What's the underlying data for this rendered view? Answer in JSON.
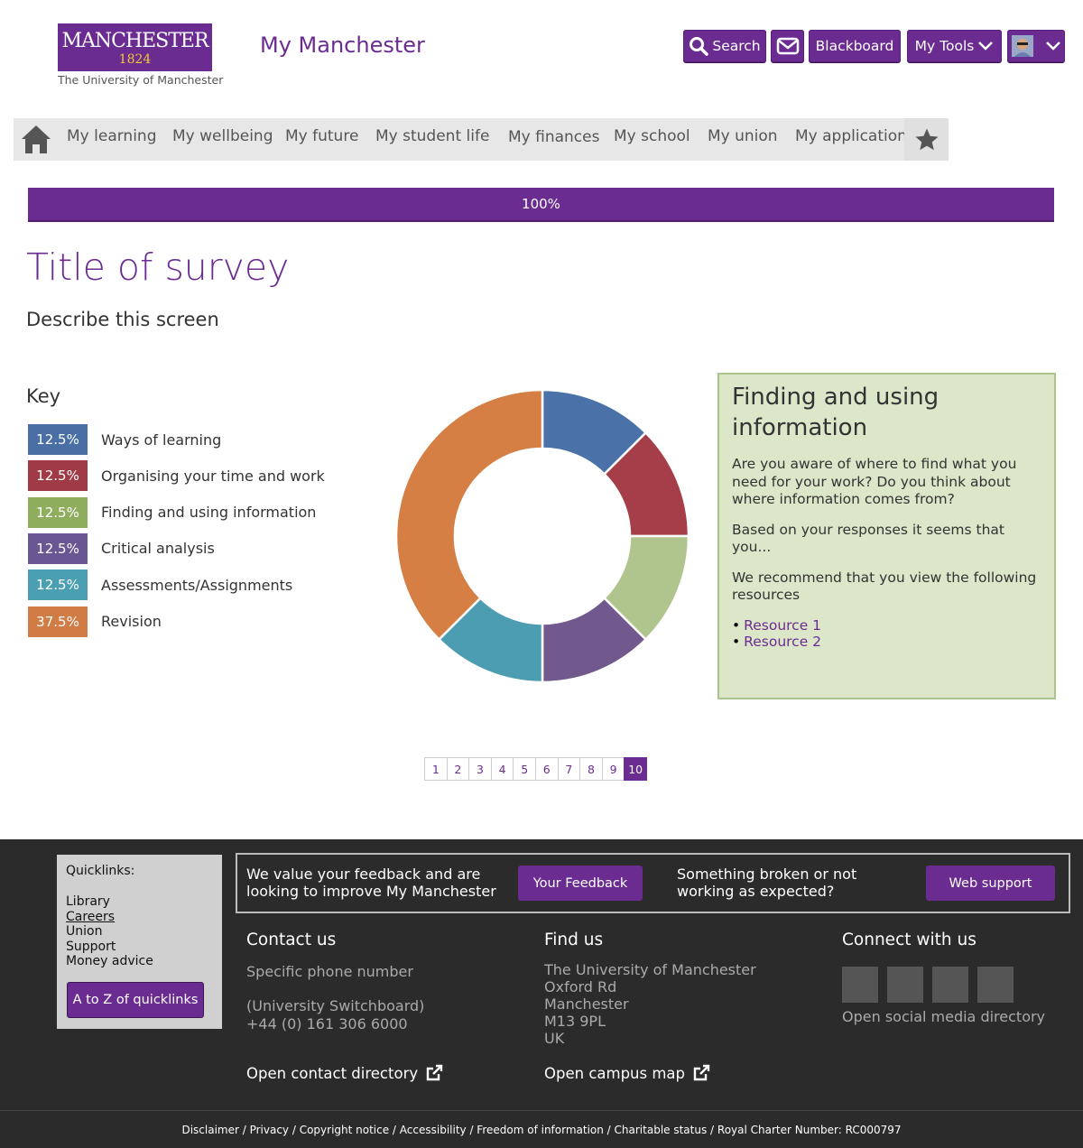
{
  "header": {
    "logo_line1": "MANCHESTER",
    "logo_line2": "1824",
    "logo_sub": "The University of Manchester",
    "site_name": "My Manchester",
    "buttons": {
      "search": "Search",
      "blackboard": "Blackboard",
      "my_tools": "My Tools"
    }
  },
  "nav": {
    "items": [
      "My learning",
      "My wellbeing",
      "My future",
      "My student life",
      "My finances",
      "My school",
      "My union",
      "My application"
    ]
  },
  "progress": {
    "label": "100%",
    "value": 1.0
  },
  "page": {
    "title": "Title of survey",
    "description": "Describe this screen"
  },
  "key": {
    "heading": "Key",
    "items": [
      {
        "pct": "12.5%",
        "label": "Ways of learning",
        "color": "#4a6fa5"
      },
      {
        "pct": "12.5%",
        "label": "Organising your time and work",
        "color": "#a03a46"
      },
      {
        "pct": "12.5%",
        "label": "Finding and using information",
        "color": "#8fae5d"
      },
      {
        "pct": "12.5%",
        "label": "Critical analysis",
        "color": "#6a5692"
      },
      {
        "pct": "12.5%",
        "label": "Assessments/Assignments",
        "color": "#4aa0b2"
      },
      {
        "pct": "37.5%",
        "label": "Revision",
        "color": "#d27c45"
      }
    ]
  },
  "chart_data": {
    "type": "pie",
    "categories": [
      "Ways of learning",
      "Organising your time and work",
      "Finding and using information",
      "Critical analysis",
      "Assessments/Assignments",
      "Revision"
    ],
    "values": [
      12.5,
      12.5,
      12.5,
      12.5,
      12.5,
      37.5
    ],
    "slice_colors": [
      "#4a72a8",
      "#a53e48",
      "#b0c48e",
      "#71598e",
      "#4c9db1",
      "#d57f44"
    ]
  },
  "info": {
    "heading": "Finding and using information",
    "p1": "Are you aware of where to find what you need for your work? Do you think about where information comes from?",
    "p2": "Based on your responses it seems that you...",
    "p3": "We recommend that you view the following resources",
    "links": [
      "Resource 1",
      "Resource 2"
    ]
  },
  "pager": {
    "pages": [
      "1",
      "2",
      "3",
      "4",
      "5",
      "6",
      "7",
      "8",
      "9",
      "10"
    ],
    "current": "10"
  },
  "footer": {
    "quicklinks_heading": "Quicklinks:",
    "quicklinks": [
      "Library",
      "Careers",
      "Union",
      "Support",
      "Money advice"
    ],
    "az_button": "A to Z of quicklinks",
    "feedback_text": "We value your feedback and are looking to improve My Manchester",
    "feedback_button": "Your Feedback",
    "support_text": "Something broken or not working as expected?",
    "support_button": "Web support",
    "contact_heading": "Contact us",
    "contact_phone_label": "Specific phone number",
    "contact_switchboard": "(University Switchboard)",
    "contact_number": "+44 (0) 161 306 6000",
    "contact_link": "Open contact directory",
    "find_heading": "Find us",
    "address": [
      "The University of Manchester",
      "Oxford Rd",
      "Manchester",
      "M13 9PL",
      "UK"
    ],
    "map_link": "Open campus map",
    "connect_heading": "Connect with us",
    "social_link": "Open social media directory",
    "legal": "Disclaimer / Privacy / Copyright notice / Accessibility / Freedom of information / Charitable status / Royal Charter Number: RC000797"
  }
}
